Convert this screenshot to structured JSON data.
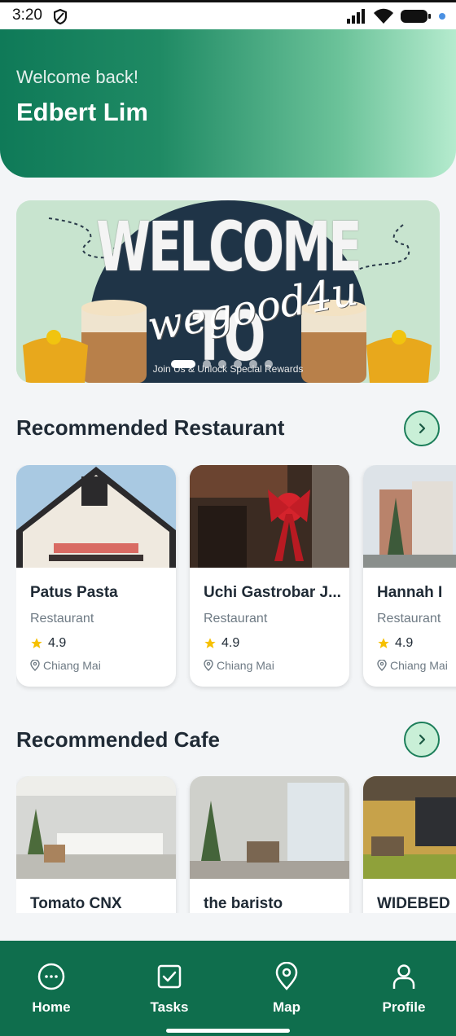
{
  "status_bar": {
    "time": "3:20"
  },
  "header": {
    "welcome": "Welcome back!",
    "name": "Edbert Lim"
  },
  "banner": {
    "title": "WELCOME TO",
    "script": "wegood4u",
    "subtitle": "Join Us & Unlock Special Rewards",
    "slide_count": 6,
    "active_slide": 1
  },
  "restaurants": {
    "title": "Recommended Restaurant",
    "arrow_icon": "chevron-right-icon",
    "items": [
      {
        "name": "Patus Pasta",
        "category": "Restaurant",
        "rating": "4.9",
        "location": "Chiang Mai"
      },
      {
        "name": "Uchi Gastrobar J...",
        "category": "Restaurant",
        "rating": "4.9",
        "location": "Chiang Mai"
      },
      {
        "name": "Hannah I",
        "category": "Restaurant",
        "rating": "4.9",
        "location": "Chiang Mai"
      }
    ]
  },
  "cafes": {
    "title": "Recommended Cafe",
    "arrow_icon": "chevron-right-icon",
    "items": [
      {
        "name": "Tomato CNX"
      },
      {
        "name": "the baristo"
      },
      {
        "name": "WIDEBED"
      }
    ]
  },
  "bottom_nav": {
    "items": [
      {
        "label": "Home",
        "icon": "home-icon"
      },
      {
        "label": "Tasks",
        "icon": "tasks-icon"
      },
      {
        "label": "Map",
        "icon": "map-pin-icon"
      },
      {
        "label": "Profile",
        "icon": "profile-icon"
      }
    ]
  },
  "colors": {
    "primary": "#0f6e4d",
    "header_start": "#0f7a58",
    "header_end": "#b5ebce",
    "star": "#f6c000"
  }
}
